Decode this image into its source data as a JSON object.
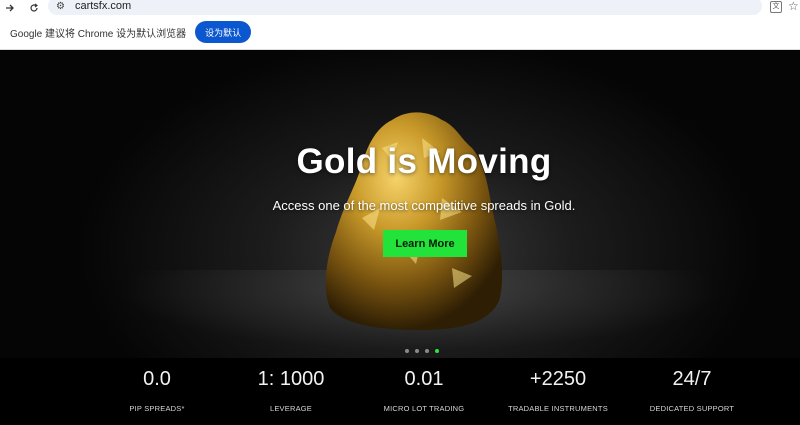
{
  "browser": {
    "url": "cartsfx.com",
    "infobar_text": "Google 建议将 Chrome 设为默认浏览器",
    "infobar_button": "设为默认"
  },
  "hero": {
    "title": "Gold is Moving",
    "subtitle": "Access one of the most competitive spreads in Gold.",
    "cta_label": "Learn More",
    "slide_count": 4,
    "active_slide": 4
  },
  "stats": [
    {
      "value": "0.0",
      "label": "PIP SPREADS*"
    },
    {
      "value": "1: 1000",
      "label": "LEVERAGE"
    },
    {
      "value": "0.01",
      "label": "MICRO LOT TRADING"
    },
    {
      "value": "+2250",
      "label": "TRADABLE INSTRUMENTS"
    },
    {
      "value": "24/7",
      "label": "DEDICATED SUPPORT"
    }
  ],
  "colors": {
    "cta_green": "#22e33a",
    "infobar_button_blue": "#0b57d0"
  },
  "icons": [
    "forward-icon",
    "reload-icon",
    "site-info-icon",
    "translate-icon",
    "bookmark-star-icon"
  ]
}
